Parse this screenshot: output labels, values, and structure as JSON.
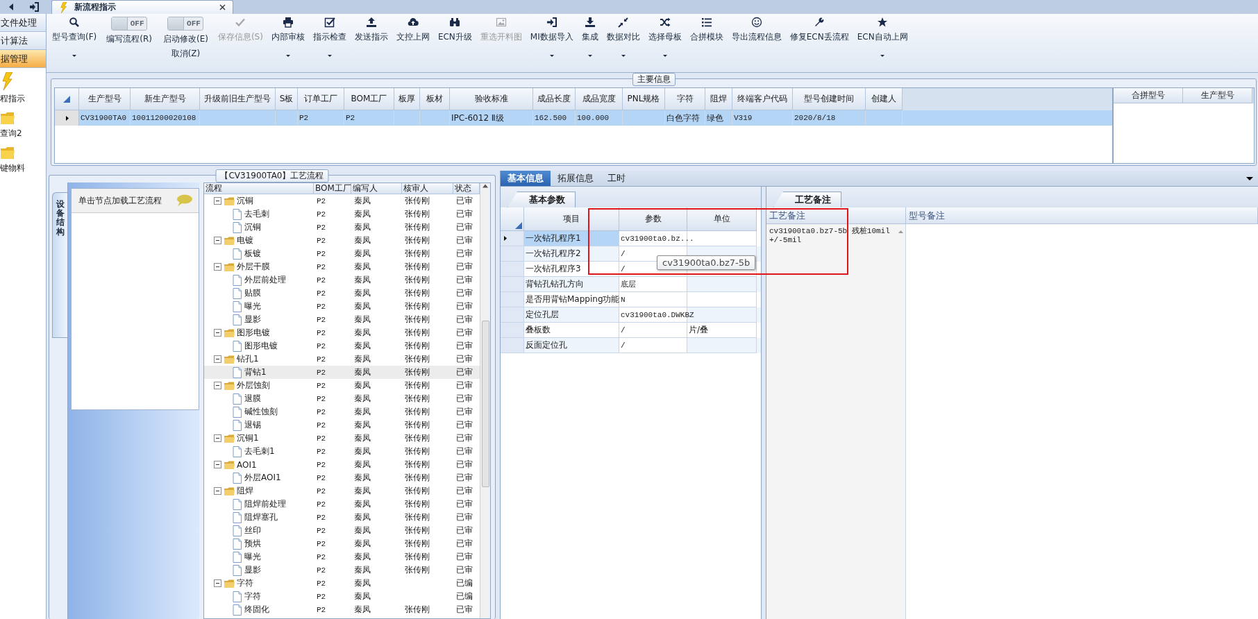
{
  "top_tab": {
    "label": "新流程指示",
    "selected": true
  },
  "nav": {
    "items": [
      {
        "label": "文件处理",
        "selected": false
      },
      {
        "label": "计算法",
        "selected": false
      },
      {
        "label": "据管理",
        "selected": true
      }
    ],
    "modules": [
      {
        "label": "程指示"
      },
      {
        "label": "查询2"
      },
      {
        "label": "键物料"
      }
    ]
  },
  "toolbar": [
    {
      "kind": "button",
      "label": "型号查询(F)",
      "disabled": false,
      "dropdown": true
    },
    {
      "kind": "toggle",
      "label": "编写流程(R)",
      "on": false,
      "state_text": "OFF"
    },
    {
      "kind": "toggle",
      "label": "启动修改(E)",
      "sublabel": "取消(Z)",
      "on": false,
      "state_text": "OFF"
    },
    {
      "kind": "button",
      "label": "保存信息(S)",
      "disabled": true,
      "dropdown": false
    },
    {
      "kind": "button",
      "label": "内部审核",
      "disabled": false,
      "dropdown": true
    },
    {
      "kind": "button",
      "label": "指示检查",
      "disabled": false,
      "dropdown": true
    },
    {
      "kind": "button",
      "label": "发送指示",
      "disabled": false,
      "dropdown": false
    },
    {
      "kind": "button",
      "label": "文控上网",
      "disabled": false,
      "dropdown": false
    },
    {
      "kind": "button",
      "label": "ECN升级",
      "disabled": false,
      "dropdown": false
    },
    {
      "kind": "button",
      "label": "重选开料图",
      "disabled": true,
      "dropdown": false
    },
    {
      "kind": "button",
      "label": "MI数据导入",
      "disabled": false,
      "dropdown": true
    },
    {
      "kind": "button",
      "label": "集成",
      "disabled": false,
      "dropdown": true
    },
    {
      "kind": "button",
      "label": "数据对比",
      "disabled": false,
      "dropdown": true
    },
    {
      "kind": "button",
      "label": "选择母板",
      "disabled": false,
      "dropdown": true
    },
    {
      "kind": "button",
      "label": "合拼模块",
      "disabled": false,
      "dropdown": false
    },
    {
      "kind": "button",
      "label": "导出流程信息",
      "disabled": false,
      "dropdown": false
    },
    {
      "kind": "button",
      "label": "修复ECN丢流程",
      "disabled": false,
      "dropdown": false
    },
    {
      "kind": "button",
      "label": "ECN自动上网",
      "disabled": false,
      "dropdown": true
    }
  ],
  "main_info": {
    "title": "主要信息",
    "columns": [
      "生产型号",
      "新生产型号",
      "升级前旧生产型号",
      "S板",
      "订单工厂",
      "BOM工厂",
      "板厚",
      "板材",
      "验收标准",
      "成品长度",
      "成品宽度",
      "PNL规格",
      "字符",
      "阻焊",
      "终端客户代码",
      "型号创建时间",
      "创建人"
    ],
    "rows": [
      {
        "selected": true,
        "cells": [
          "CV31900TA0",
          "10011200020108",
          null,
          null,
          "P2",
          "P2",
          null,
          null,
          "IPC-6012 Ⅱ级",
          "162.500",
          "100.000",
          null,
          "白色字符",
          "绿色",
          "V319",
          "2020/8/18",
          null
        ]
      }
    ],
    "side_columns": [
      "合拼型号",
      "生产型号"
    ]
  },
  "process": {
    "title": "【CV31900TA0】工艺流程",
    "side_tab": "设备结构",
    "hint": "单击节点加载工艺流程",
    "columns": [
      "流程",
      "BOM工厂",
      "编写人",
      "核审人",
      "状态"
    ],
    "tree": [
      {
        "name": "沉铜",
        "bom": "P2",
        "writer": "秦凤",
        "reviewer": "张传刚",
        "status": "已审",
        "expanded": true,
        "selected": false,
        "children": [
          {
            "name": "去毛刺",
            "bom": "P2",
            "writer": "秦凤",
            "reviewer": "张传刚",
            "status": "已审",
            "selected": false
          },
          {
            "name": "沉铜",
            "bom": "P2",
            "writer": "秦凤",
            "reviewer": "张传刚",
            "status": "已审",
            "selected": false
          }
        ]
      },
      {
        "name": "电镀",
        "bom": "P2",
        "writer": "秦凤",
        "reviewer": "张传刚",
        "status": "已审",
        "expanded": true,
        "selected": false,
        "children": [
          {
            "name": "板镀",
            "bom": "P2",
            "writer": "秦凤",
            "reviewer": "张传刚",
            "status": "已审",
            "selected": false
          }
        ]
      },
      {
        "name": "外层干膜",
        "bom": "P2",
        "writer": "秦凤",
        "reviewer": "张传刚",
        "status": "已审",
        "expanded": true,
        "selected": false,
        "children": [
          {
            "name": "外层前处理",
            "bom": "P2",
            "writer": "秦凤",
            "reviewer": "张传刚",
            "status": "已审",
            "selected": false
          },
          {
            "name": "贴膜",
            "bom": "P2",
            "writer": "秦凤",
            "reviewer": "张传刚",
            "status": "已审",
            "selected": false
          },
          {
            "name": "曝光",
            "bom": "P2",
            "writer": "秦凤",
            "reviewer": "张传刚",
            "status": "已审",
            "selected": false
          },
          {
            "name": "显影",
            "bom": "P2",
            "writer": "秦凤",
            "reviewer": "张传刚",
            "status": "已审",
            "selected": false
          }
        ]
      },
      {
        "name": "图形电镀",
        "bom": "P2",
        "writer": "秦凤",
        "reviewer": "张传刚",
        "status": "已审",
        "expanded": true,
        "selected": false,
        "children": [
          {
            "name": "图形电镀",
            "bom": "P2",
            "writer": "秦凤",
            "reviewer": "张传刚",
            "status": "已审",
            "selected": false
          }
        ]
      },
      {
        "name": "钻孔1",
        "bom": "P2",
        "writer": "秦凤",
        "reviewer": "张传刚",
        "status": "已审",
        "expanded": true,
        "selected": false,
        "children": [
          {
            "name": "背钻1",
            "bom": "P2",
            "writer": "秦凤",
            "reviewer": "张传刚",
            "status": "已审",
            "selected": true
          }
        ]
      },
      {
        "name": "外层蚀刻",
        "bom": "P2",
        "writer": "秦凤",
        "reviewer": "张传刚",
        "status": "已审",
        "expanded": true,
        "selected": false,
        "children": [
          {
            "name": "退膜",
            "bom": "P2",
            "writer": "秦凤",
            "reviewer": "张传刚",
            "status": "已审",
            "selected": false
          },
          {
            "name": "碱性蚀刻",
            "bom": "P2",
            "writer": "秦凤",
            "reviewer": "张传刚",
            "status": "已审",
            "selected": false
          },
          {
            "name": "退锡",
            "bom": "P2",
            "writer": "秦凤",
            "reviewer": "张传刚",
            "status": "已审",
            "selected": false
          }
        ]
      },
      {
        "name": "沉铜1",
        "bom": "P2",
        "writer": "秦凤",
        "reviewer": "张传刚",
        "status": "已审",
        "expanded": true,
        "selected": false,
        "children": [
          {
            "name": "去毛刺1",
            "bom": "P2",
            "writer": "秦凤",
            "reviewer": "张传刚",
            "status": "已审",
            "selected": false
          }
        ]
      },
      {
        "name": "AOI1",
        "bom": "P2",
        "writer": "秦凤",
        "reviewer": "张传刚",
        "status": "已审",
        "expanded": true,
        "selected": false,
        "children": [
          {
            "name": "外层AOI1",
            "bom": "P2",
            "writer": "秦凤",
            "reviewer": "张传刚",
            "status": "已审",
            "selected": false
          }
        ]
      },
      {
        "name": "阻焊",
        "bom": "P2",
        "writer": "秦凤",
        "reviewer": "张传刚",
        "status": "已审",
        "expanded": true,
        "selected": false,
        "children": [
          {
            "name": "阻焊前处理",
            "bom": "P2",
            "writer": "秦凤",
            "reviewer": "张传刚",
            "status": "已审",
            "selected": false
          },
          {
            "name": "阻焊塞孔",
            "bom": "P2",
            "writer": "秦凤",
            "reviewer": "张传刚",
            "status": "已审",
            "selected": false
          },
          {
            "name": "丝印",
            "bom": "P2",
            "writer": "秦凤",
            "reviewer": "张传刚",
            "status": "已审",
            "selected": false
          },
          {
            "name": "预烘",
            "bom": "P2",
            "writer": "秦凤",
            "reviewer": "张传刚",
            "status": "已审",
            "selected": false
          },
          {
            "name": "曝光",
            "bom": "P2",
            "writer": "秦凤",
            "reviewer": "张传刚",
            "status": "已审",
            "selected": false
          },
          {
            "name": "显影",
            "bom": "P2",
            "writer": "秦凤",
            "reviewer": "张传刚",
            "status": "已审",
            "selected": false
          }
        ]
      },
      {
        "name": "字符",
        "bom": "P2",
        "writer": "秦凤",
        "status": "已编",
        "expanded": true,
        "selected": false,
        "children": [
          {
            "name": "字符",
            "bom": "P2",
            "writer": "秦凤",
            "status": "已编",
            "selected": false
          },
          {
            "name": "终固化",
            "bom": "P2",
            "writer": "秦凤",
            "reviewer": "张传刚",
            "status": "已审",
            "selected": false
          }
        ]
      }
    ]
  },
  "detail": {
    "tabs": [
      {
        "label": "基本信息",
        "selected": true
      },
      {
        "label": "拓展信息",
        "selected": false
      },
      {
        "label": "工时",
        "selected": false
      }
    ],
    "params": {
      "tab": "基本参数",
      "columns": [
        "项目",
        "参数",
        "单位"
      ],
      "rows": [
        {
          "item": "一次钻孔程序1",
          "value": "cv31900ta0.bz...",
          "selected": true
        },
        {
          "item": "一次钻孔程序2",
          "value": "/",
          "selected": false
        },
        {
          "item": "一次钻孔程序3",
          "value": "/",
          "selected": false
        },
        {
          "item": "背钻孔钻孔方向",
          "value": "底层",
          "selected": false
        },
        {
          "item": "是否用背钻Mapping功能",
          "value": "N",
          "selected": false
        },
        {
          "item": "定位孔层",
          "value": "cv31900ta0.DWKBZ",
          "selected": false
        },
        {
          "item": "叠板数",
          "value": "/",
          "unit": "片/叠",
          "selected": false
        },
        {
          "item": "反面定位孔",
          "value": "/",
          "selected": false
        }
      ]
    },
    "tooltip": "cv31900ta0.bz7-5b",
    "notes": {
      "tab": "工艺备注",
      "columns": [
        "工艺备注",
        "型号备注"
      ],
      "text": "cv31900ta0.bz7-5b 残桩10mil +/-5mil"
    }
  }
}
